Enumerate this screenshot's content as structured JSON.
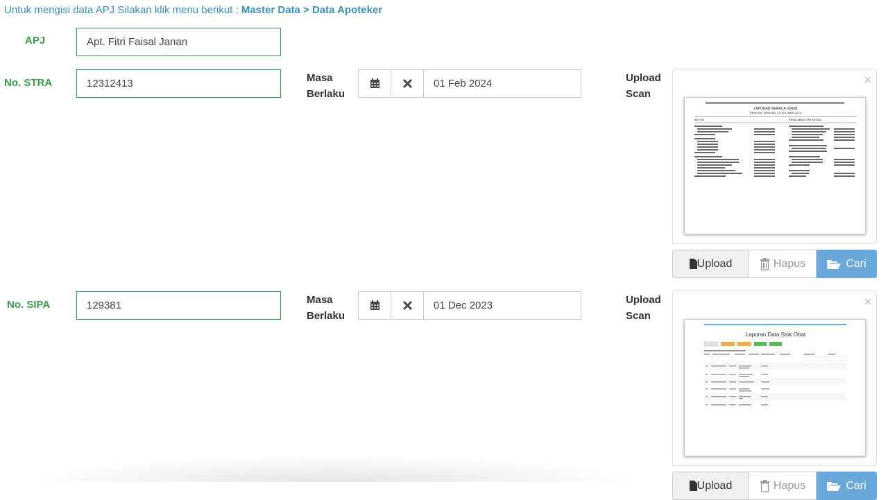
{
  "hint": {
    "prefix": "Untuk mengisi data APJ Silakan klik menu berikut : ",
    "path": "Master Data > Data Apoteker"
  },
  "apj": {
    "label": "APJ",
    "value": "Apt. Fitri Faisal Janan"
  },
  "stra": {
    "label": "No. STRA",
    "value": "12312413",
    "masa_line1": "Masa",
    "masa_line2": "Berlaku",
    "date": "01 Feb 2024",
    "upload_line1": "Upload",
    "upload_line2": "Scan",
    "preview": {
      "header": "LAPORAN NERACA UMUM",
      "subheader": "PERIODE TANGGAL 27 OKTOBER 2023",
      "col_left": "AKTIVA",
      "col_right": "KEWAJIBAN DAN MODAL"
    }
  },
  "sipa": {
    "label": "No. SIPA",
    "value": "129381",
    "masa_line1": "Masa",
    "masa_line2": "Berlaku",
    "date": "01 Dec 2023",
    "upload_line1": "Upload",
    "upload_line2": "Scan",
    "preview": {
      "header": "Laporan Data Stok Obat"
    }
  },
  "buttons": {
    "upload": "Upload",
    "hapus": "Hapus",
    "cari": "Cari"
  },
  "icons": {
    "calendar": "calendar-icon",
    "clear": "times-icon",
    "file": "file-icon",
    "trash": "trash-icon",
    "folder": "folder-open-icon",
    "close": "close-icon"
  },
  "colors": {
    "label_green": "#3c9a4e",
    "link_blue": "#3c8dbc",
    "cari_blue": "#6aa8d9"
  }
}
